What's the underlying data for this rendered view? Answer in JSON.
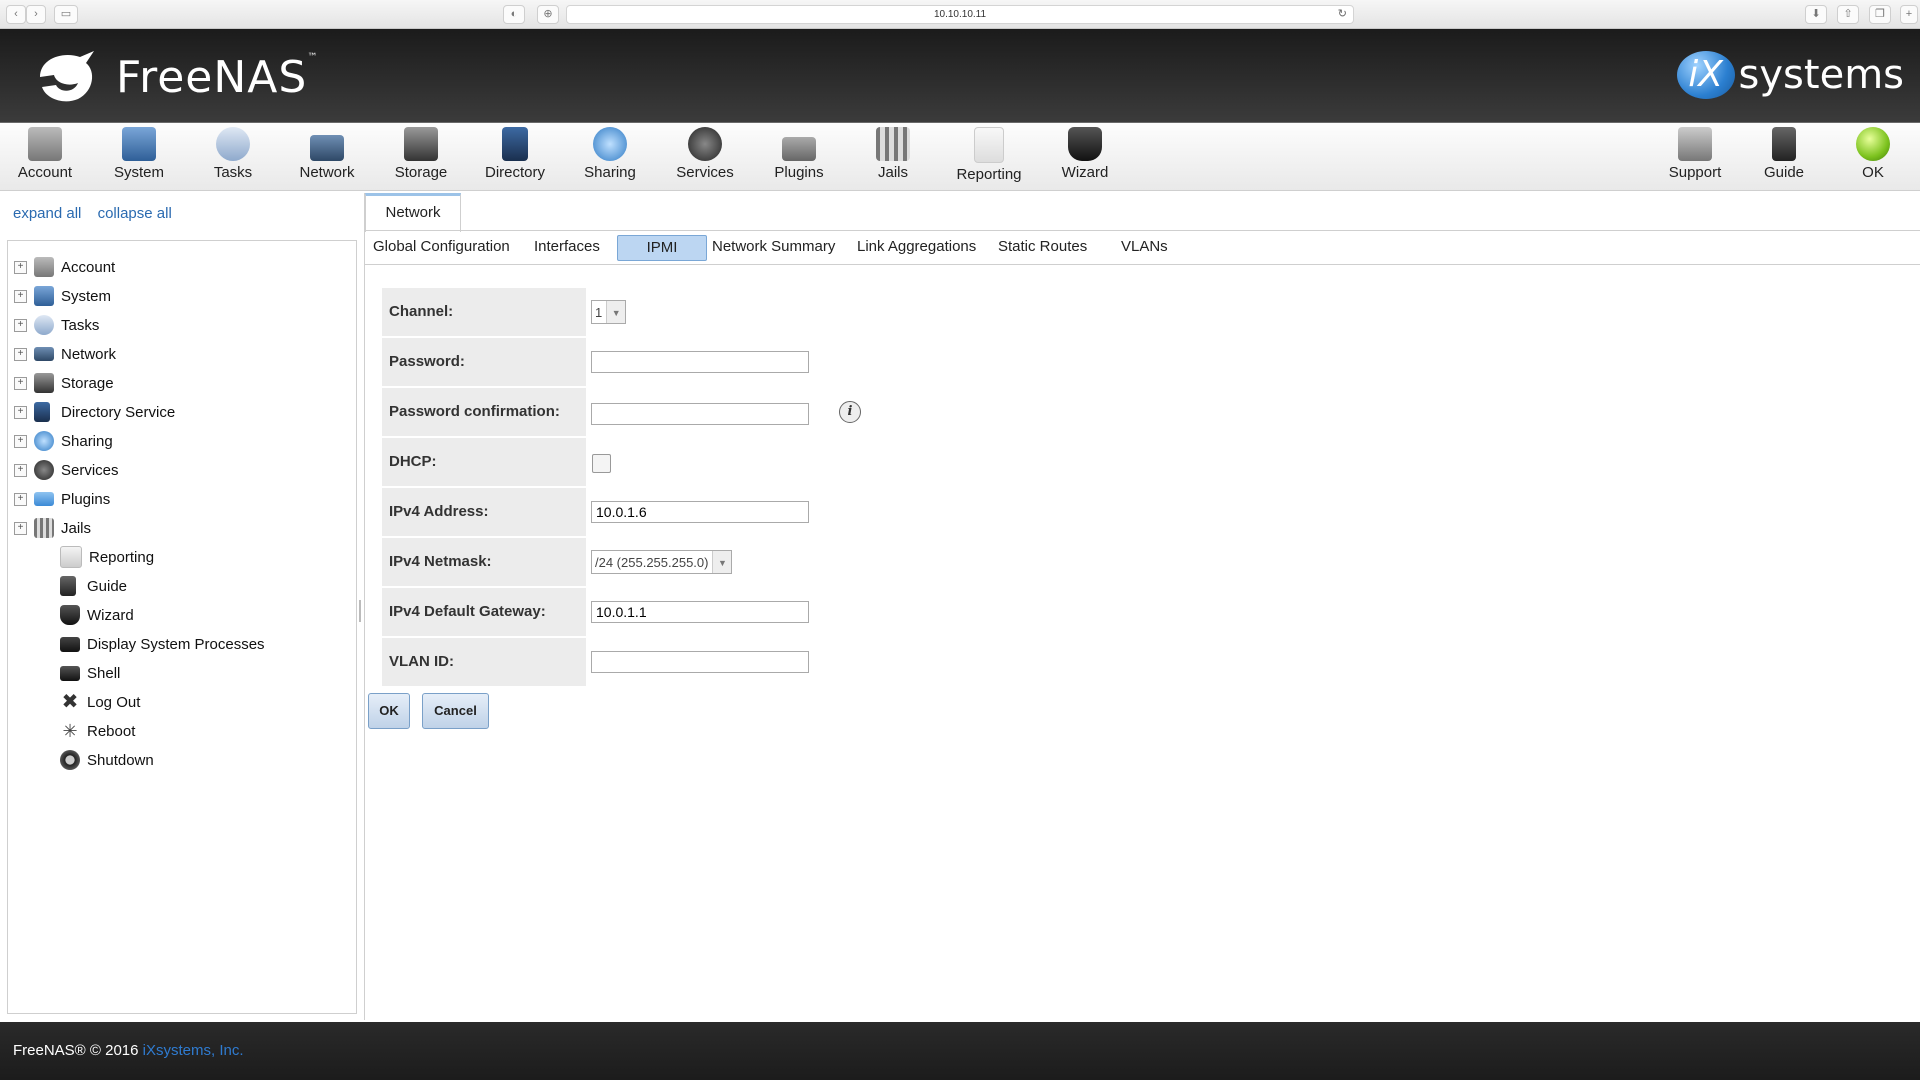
{
  "browser": {
    "url": "10.10.10.11"
  },
  "header": {
    "product_name": "FreeNAS",
    "vendor_name": "systems",
    "vendor_mark": "iX"
  },
  "toolbar": {
    "left": [
      {
        "label": "Account",
        "icon": "account-icon"
      },
      {
        "label": "System",
        "icon": "system-icon"
      },
      {
        "label": "Tasks",
        "icon": "tasks-icon"
      },
      {
        "label": "Network",
        "icon": "network-icon"
      },
      {
        "label": "Storage",
        "icon": "storage-icon"
      },
      {
        "label": "Directory",
        "icon": "directory-icon"
      },
      {
        "label": "Sharing",
        "icon": "sharing-icon"
      },
      {
        "label": "Services",
        "icon": "services-icon"
      },
      {
        "label": "Plugins",
        "icon": "plugins-icon"
      },
      {
        "label": "Jails",
        "icon": "jails-icon"
      },
      {
        "label": "Reporting",
        "icon": "reporting-icon"
      },
      {
        "label": "Wizard",
        "icon": "wizard-icon"
      }
    ],
    "right": [
      {
        "label": "Support",
        "icon": "support-icon"
      },
      {
        "label": "Guide",
        "icon": "guide-icon"
      },
      {
        "label": "OK",
        "icon": "status-ok-icon"
      }
    ]
  },
  "sidebar": {
    "expand_all": "expand all",
    "collapse_all": "collapse all",
    "items": [
      {
        "label": "Account",
        "expandable": true
      },
      {
        "label": "System",
        "expandable": true
      },
      {
        "label": "Tasks",
        "expandable": true
      },
      {
        "label": "Network",
        "expandable": true
      },
      {
        "label": "Storage",
        "expandable": true
      },
      {
        "label": "Directory Service",
        "expandable": true
      },
      {
        "label": "Sharing",
        "expandable": true
      },
      {
        "label": "Services",
        "expandable": true
      },
      {
        "label": "Plugins",
        "expandable": true
      },
      {
        "label": "Jails",
        "expandable": true
      },
      {
        "label": "Reporting",
        "expandable": false
      },
      {
        "label": "Guide",
        "expandable": false
      },
      {
        "label": "Wizard",
        "expandable": false
      },
      {
        "label": "Display System Processes",
        "expandable": false
      },
      {
        "label": "Shell",
        "expandable": false
      },
      {
        "label": "Log Out",
        "expandable": false
      },
      {
        "label": "Reboot",
        "expandable": false
      },
      {
        "label": "Shutdown",
        "expandable": false
      }
    ]
  },
  "main": {
    "tab": "Network",
    "subtabs": [
      "Global Configuration",
      "Interfaces",
      "IPMI",
      "Network Summary",
      "Link Aggregations",
      "Static Routes",
      "VLANs"
    ],
    "active_subtab": "IPMI",
    "form": {
      "channel": {
        "label": "Channel:",
        "value": "1"
      },
      "password": {
        "label": "Password:",
        "value": ""
      },
      "password_confirm": {
        "label": "Password confirmation:",
        "value": ""
      },
      "dhcp": {
        "label": "DHCP:",
        "checked": false
      },
      "ipv4_address": {
        "label": "IPv4 Address:",
        "value": "10.0.1.6"
      },
      "ipv4_netmask": {
        "label": "IPv4 Netmask:",
        "value": "/24 (255.255.255.0)"
      },
      "ipv4_gateway": {
        "label": "IPv4 Default Gateway:",
        "value": "10.0.1.1"
      },
      "vlan_id": {
        "label": "VLAN ID:",
        "value": ""
      }
    },
    "ok_label": "OK",
    "cancel_label": "Cancel"
  },
  "footer": {
    "copyright": "FreeNAS® © 2016 ",
    "company": "iXsystems, Inc."
  }
}
